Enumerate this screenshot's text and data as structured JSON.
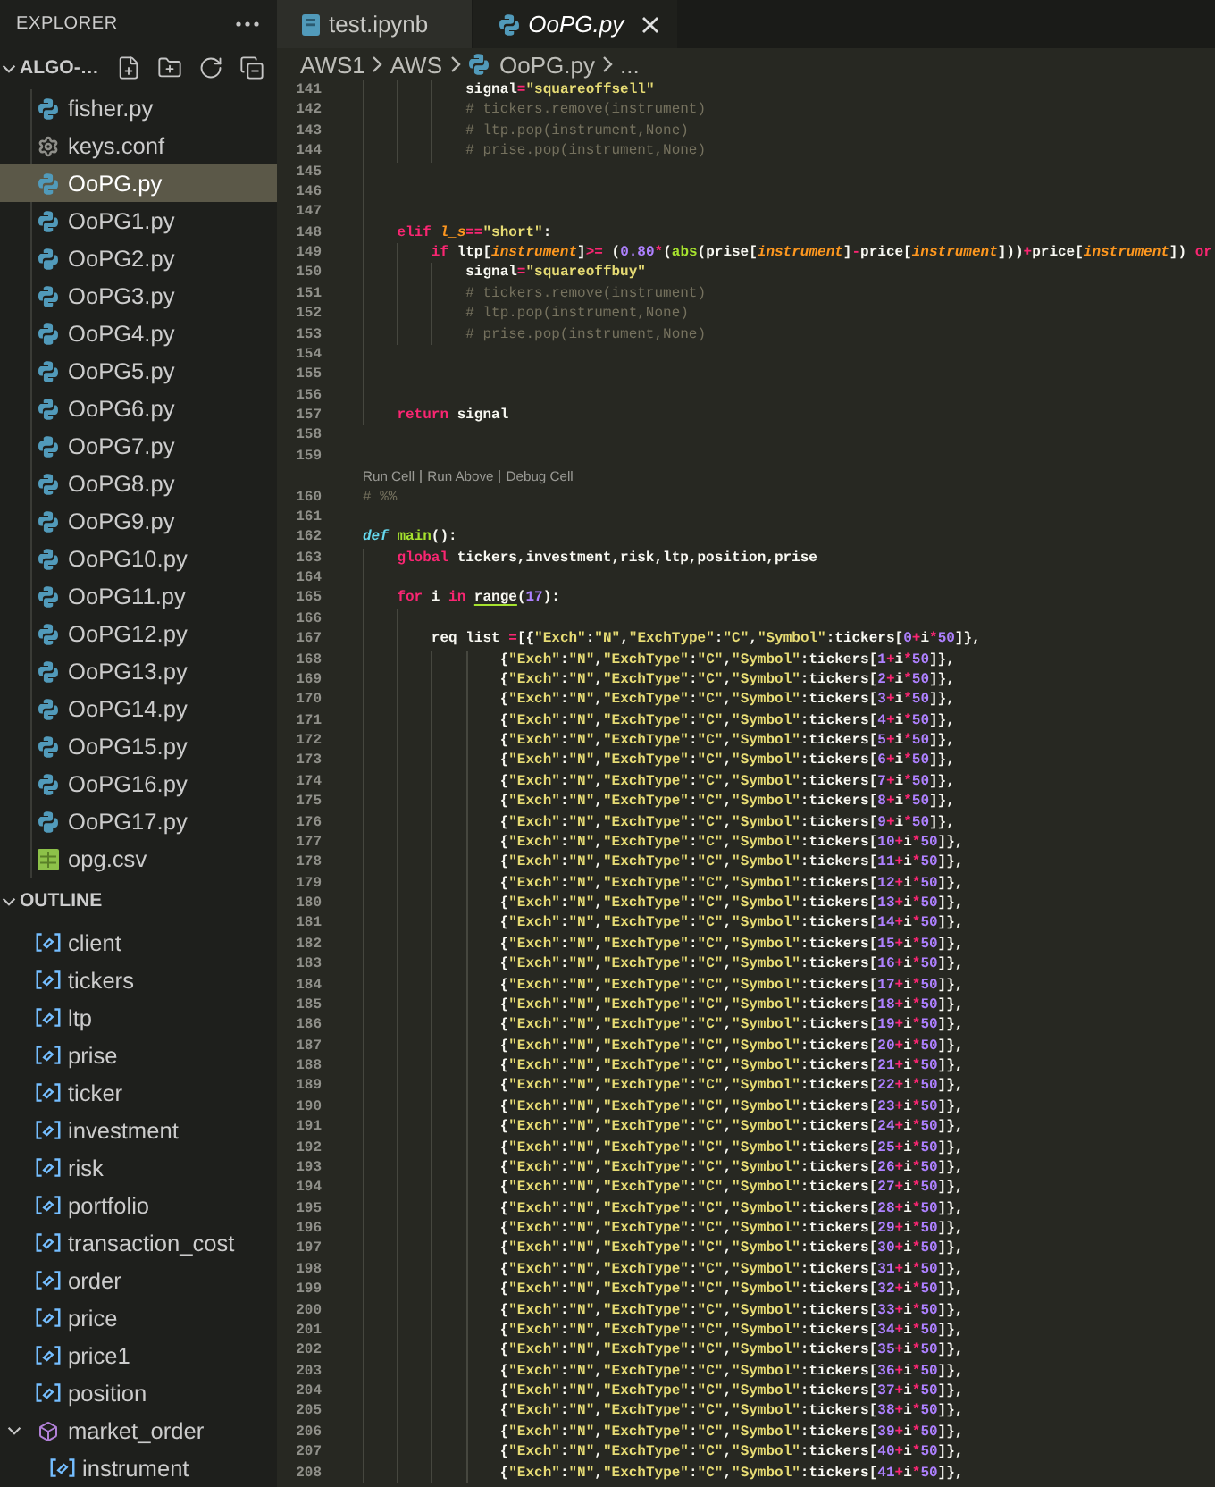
{
  "explorer": {
    "title": "EXPLORER",
    "folder": {
      "name": "ALGO-…",
      "expanded": true
    },
    "files": [
      {
        "name": "fisher.py",
        "kind": "python",
        "selected": false
      },
      {
        "name": "keys.conf",
        "kind": "settings",
        "selected": false
      },
      {
        "name": "OoPG.py",
        "kind": "python",
        "selected": true
      },
      {
        "name": "OoPG1.py",
        "kind": "python",
        "selected": false
      },
      {
        "name": "OoPG2.py",
        "kind": "python",
        "selected": false
      },
      {
        "name": "OoPG3.py",
        "kind": "python",
        "selected": false
      },
      {
        "name": "OoPG4.py",
        "kind": "python",
        "selected": false
      },
      {
        "name": "OoPG5.py",
        "kind": "python",
        "selected": false
      },
      {
        "name": "OoPG6.py",
        "kind": "python",
        "selected": false
      },
      {
        "name": "OoPG7.py",
        "kind": "python",
        "selected": false
      },
      {
        "name": "OoPG8.py",
        "kind": "python",
        "selected": false
      },
      {
        "name": "OoPG9.py",
        "kind": "python",
        "selected": false
      },
      {
        "name": "OoPG10.py",
        "kind": "python",
        "selected": false
      },
      {
        "name": "OoPG11.py",
        "kind": "python",
        "selected": false
      },
      {
        "name": "OoPG12.py",
        "kind": "python",
        "selected": false
      },
      {
        "name": "OoPG13.py",
        "kind": "python",
        "selected": false
      },
      {
        "name": "OoPG14.py",
        "kind": "python",
        "selected": false
      },
      {
        "name": "OoPG15.py",
        "kind": "python",
        "selected": false
      },
      {
        "name": "OoPG16.py",
        "kind": "python",
        "selected": false
      },
      {
        "name": "OoPG17.py",
        "kind": "python",
        "selected": false
      },
      {
        "name": "opg.csv",
        "kind": "csv",
        "selected": false
      }
    ]
  },
  "outline": {
    "title": "OUTLINE",
    "expanded": true,
    "symbols": [
      {
        "name": "client",
        "kind": "variable"
      },
      {
        "name": "tickers",
        "kind": "variable"
      },
      {
        "name": "ltp",
        "kind": "variable"
      },
      {
        "name": "prise",
        "kind": "variable"
      },
      {
        "name": "ticker",
        "kind": "variable"
      },
      {
        "name": "investment",
        "kind": "variable"
      },
      {
        "name": "risk",
        "kind": "variable"
      },
      {
        "name": "portfolio",
        "kind": "variable"
      },
      {
        "name": "transaction_cost",
        "kind": "variable"
      },
      {
        "name": "order",
        "kind": "variable"
      },
      {
        "name": "price",
        "kind": "variable"
      },
      {
        "name": "price1",
        "kind": "variable"
      },
      {
        "name": "position",
        "kind": "variable"
      },
      {
        "name": "market_order",
        "kind": "method",
        "expanded": true,
        "children": [
          {
            "name": "instrument",
            "kind": "variable"
          }
        ]
      }
    ]
  },
  "tabs": [
    {
      "label": "test.ipynb",
      "kind": "notebook",
      "selected": false,
      "preview": false
    },
    {
      "label": "OoPG.py",
      "kind": "python",
      "selected": true,
      "preview": true
    }
  ],
  "breadcrumbs": [
    {
      "label": "AWS1",
      "kind": "folder"
    },
    {
      "label": "AWS",
      "kind": "folder"
    },
    {
      "label": "OoPG.py",
      "kind": "python"
    },
    {
      "label": "...",
      "kind": "symbol"
    }
  ],
  "editor": {
    "lines": [
      {
        "number": "141",
        "text": "            signal=\"squareoffsell\""
      },
      {
        "number": "142",
        "text": "            # tickers.remove(instrument)"
      },
      {
        "number": "143",
        "text": "            # ltp.pop(instrument,None)"
      },
      {
        "number": "144",
        "text": "            # prise.pop(instrument,None)"
      },
      {
        "number": "145"
      },
      {
        "number": "146"
      },
      {
        "number": "147"
      },
      {
        "number": "148",
        "tokens": [
          {
            "kind": "keyword",
            "text": "    elif "
          },
          {
            "kind": "param",
            "text": "l_s"
          },
          {
            "kind": "code",
            "text": "==\"short\":"
          }
        ]
      },
      {
        "number": "149",
        "tokens": [
          {
            "kind": "keyword",
            "text": "        if "
          },
          {
            "kind": "code",
            "text": "ltp["
          },
          {
            "kind": "param",
            "text": "instrument"
          },
          {
            "kind": "code",
            "text": "]>= (0.80*("
          },
          {
            "kind": "call",
            "text": "abs"
          },
          {
            "kind": "code",
            "text": "(prise["
          },
          {
            "kind": "param",
            "text": "instrument"
          },
          {
            "kind": "code",
            "text": "]-price["
          },
          {
            "kind": "param",
            "text": "instrument"
          },
          {
            "kind": "code",
            "text": "]))+price["
          },
          {
            "kind": "param",
            "text": "instrument"
          },
          {
            "kind": "code",
            "text": "]) "
          },
          {
            "kind": "keyword",
            "text": "or"
          }
        ]
      },
      {
        "number": "150",
        "text": "            signal=\"squareoffbuy\""
      },
      {
        "number": "151",
        "text": "            # tickers.remove(instrument)"
      },
      {
        "number": "152",
        "text": "            # ltp.pop(instrument,None)"
      },
      {
        "number": "153",
        "text": "            # prise.pop(instrument,None)"
      },
      {
        "number": "154"
      },
      {
        "number": "155"
      },
      {
        "number": "156"
      },
      {
        "number": "157",
        "tokens": [
          {
            "kind": "keyword",
            "text": "    return "
          },
          {
            "kind": "code",
            "text": "signal"
          }
        ]
      },
      {
        "number": "158"
      },
      {
        "number": "159"
      },
      {
        "number": "160",
        "codelens": [
          "Run Cell",
          "Run Above",
          "Debug Cell"
        ],
        "text": "# %%"
      },
      {
        "number": "161"
      },
      {
        "number": "162",
        "tokens": [
          {
            "kind": "storage",
            "text": "def "
          },
          {
            "kind": "function",
            "text": "main"
          },
          {
            "kind": "code",
            "text": "():"
          }
        ]
      },
      {
        "number": "163",
        "tokens": [
          {
            "kind": "keyword",
            "text": "    global "
          },
          {
            "kind": "code",
            "text": "tickers,investment,risk,ltp,position,prise"
          }
        ]
      },
      {
        "number": "164"
      },
      {
        "number": "165",
        "tokens": [
          {
            "kind": "keyword",
            "text": "    for "
          },
          {
            "kind": "code",
            "text": "i "
          },
          {
            "kind": "keyword",
            "text": "in "
          },
          {
            "kind": "underlined",
            "text": "range"
          },
          {
            "kind": "code",
            "text": "(17):"
          }
        ]
      },
      {
        "number": "166"
      },
      {
        "number": "167",
        "text": "        req_list_=[{\"Exch\":\"N\",\"ExchType\":\"C\",\"Symbol\":tickers[0+i*50]},"
      },
      {
        "number": "168",
        "text": "                {\"Exch\":\"N\",\"ExchType\":\"C\",\"Symbol\":tickers[1+i*50]},"
      },
      {
        "number": "169",
        "text": "                {\"Exch\":\"N\",\"ExchType\":\"C\",\"Symbol\":tickers[2+i*50]},"
      },
      {
        "number": "170",
        "text": "                {\"Exch\":\"N\",\"ExchType\":\"C\",\"Symbol\":tickers[3+i*50]},"
      },
      {
        "number": "171",
        "text": "                {\"Exch\":\"N\",\"ExchType\":\"C\",\"Symbol\":tickers[4+i*50]},"
      },
      {
        "number": "172",
        "text": "                {\"Exch\":\"N\",\"ExchType\":\"C\",\"Symbol\":tickers[5+i*50]},"
      },
      {
        "number": "173",
        "text": "                {\"Exch\":\"N\",\"ExchType\":\"C\",\"Symbol\":tickers[6+i*50]},"
      },
      {
        "number": "174",
        "text": "                {\"Exch\":\"N\",\"ExchType\":\"C\",\"Symbol\":tickers[7+i*50]},"
      },
      {
        "number": "175",
        "text": "                {\"Exch\":\"N\",\"ExchType\":\"C\",\"Symbol\":tickers[8+i*50]},"
      },
      {
        "number": "176",
        "text": "                {\"Exch\":\"N\",\"ExchType\":\"C\",\"Symbol\":tickers[9+i*50]},"
      },
      {
        "number": "177",
        "text": "                {\"Exch\":\"N\",\"ExchType\":\"C\",\"Symbol\":tickers[10+i*50]},"
      },
      {
        "number": "178",
        "text": "                {\"Exch\":\"N\",\"ExchType\":\"C\",\"Symbol\":tickers[11+i*50]},"
      },
      {
        "number": "179",
        "text": "                {\"Exch\":\"N\",\"ExchType\":\"C\",\"Symbol\":tickers[12+i*50]},"
      },
      {
        "number": "180",
        "text": "                {\"Exch\":\"N\",\"ExchType\":\"C\",\"Symbol\":tickers[13+i*50]},"
      },
      {
        "number": "181",
        "text": "                {\"Exch\":\"N\",\"ExchType\":\"C\",\"Symbol\":tickers[14+i*50]},"
      },
      {
        "number": "182",
        "text": "                {\"Exch\":\"N\",\"ExchType\":\"C\",\"Symbol\":tickers[15+i*50]},"
      },
      {
        "number": "183",
        "text": "                {\"Exch\":\"N\",\"ExchType\":\"C\",\"Symbol\":tickers[16+i*50]},"
      },
      {
        "number": "184",
        "text": "                {\"Exch\":\"N\",\"ExchType\":\"C\",\"Symbol\":tickers[17+i*50]},"
      },
      {
        "number": "185",
        "text": "                {\"Exch\":\"N\",\"ExchType\":\"C\",\"Symbol\":tickers[18+i*50]},"
      },
      {
        "number": "186",
        "text": "                {\"Exch\":\"N\",\"ExchType\":\"C\",\"Symbol\":tickers[19+i*50]},"
      },
      {
        "number": "187",
        "text": "                {\"Exch\":\"N\",\"ExchType\":\"C\",\"Symbol\":tickers[20+i*50]},"
      },
      {
        "number": "188",
        "text": "                {\"Exch\":\"N\",\"ExchType\":\"C\",\"Symbol\":tickers[21+i*50]},"
      },
      {
        "number": "189",
        "text": "                {\"Exch\":\"N\",\"ExchType\":\"C\",\"Symbol\":tickers[22+i*50]},"
      },
      {
        "number": "190",
        "text": "                {\"Exch\":\"N\",\"ExchType\":\"C\",\"Symbol\":tickers[23+i*50]},"
      },
      {
        "number": "191",
        "text": "                {\"Exch\":\"N\",\"ExchType\":\"C\",\"Symbol\":tickers[24+i*50]},"
      },
      {
        "number": "192",
        "text": "                {\"Exch\":\"N\",\"ExchType\":\"C\",\"Symbol\":tickers[25+i*50]},"
      },
      {
        "number": "193",
        "text": "                {\"Exch\":\"N\",\"ExchType\":\"C\",\"Symbol\":tickers[26+i*50]},"
      },
      {
        "number": "194",
        "text": "                {\"Exch\":\"N\",\"ExchType\":\"C\",\"Symbol\":tickers[27+i*50]},"
      },
      {
        "number": "195",
        "text": "                {\"Exch\":\"N\",\"ExchType\":\"C\",\"Symbol\":tickers[28+i*50]},"
      },
      {
        "number": "196",
        "text": "                {\"Exch\":\"N\",\"ExchType\":\"C\",\"Symbol\":tickers[29+i*50]},"
      },
      {
        "number": "197",
        "text": "                {\"Exch\":\"N\",\"ExchType\":\"C\",\"Symbol\":tickers[30+i*50]},"
      },
      {
        "number": "198",
        "text": "                {\"Exch\":\"N\",\"ExchType\":\"C\",\"Symbol\":tickers[31+i*50]},"
      },
      {
        "number": "199",
        "text": "                {\"Exch\":\"N\",\"ExchType\":\"C\",\"Symbol\":tickers[32+i*50]},"
      },
      {
        "number": "200",
        "text": "                {\"Exch\":\"N\",\"ExchType\":\"C\",\"Symbol\":tickers[33+i*50]},"
      },
      {
        "number": "201",
        "text": "                {\"Exch\":\"N\",\"ExchType\":\"C\",\"Symbol\":tickers[34+i*50]},"
      },
      {
        "number": "202",
        "text": "                {\"Exch\":\"N\",\"ExchType\":\"C\",\"Symbol\":tickers[35+i*50]},"
      },
      {
        "number": "203",
        "text": "                {\"Exch\":\"N\",\"ExchType\":\"C\",\"Symbol\":tickers[36+i*50]},"
      },
      {
        "number": "204",
        "text": "                {\"Exch\":\"N\",\"ExchType\":\"C\",\"Symbol\":tickers[37+i*50]},"
      },
      {
        "number": "205",
        "text": "                {\"Exch\":\"N\",\"ExchType\":\"C\",\"Symbol\":tickers[38+i*50]},"
      },
      {
        "number": "206",
        "text": "                {\"Exch\":\"N\",\"ExchType\":\"C\",\"Symbol\":tickers[39+i*50]},"
      },
      {
        "number": "207",
        "text": "                {\"Exch\":\"N\",\"ExchType\":\"C\",\"Symbol\":tickers[40+i*50]},"
      },
      {
        "number": "208",
        "text": "                {\"Exch\":\"N\",\"ExchType\":\"C\",\"Symbol\":tickers[41+i*50]},"
      }
    ]
  }
}
